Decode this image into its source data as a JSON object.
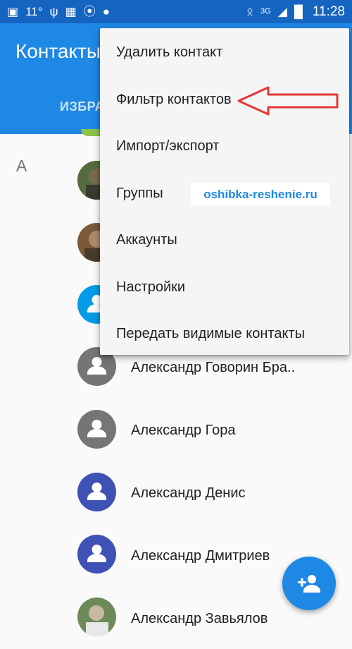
{
  "status_bar": {
    "temperature": "11°",
    "network": "3G",
    "time": "11:28"
  },
  "app_bar": {
    "title": "Контакты",
    "tab_favorites": "ИЗБРА"
  },
  "contacts": {
    "section_letter": "А",
    "items": [
      {
        "name": ""
      },
      {
        "name": ""
      },
      {
        "name": ""
      },
      {
        "name": "Александр Говорин Бра.."
      },
      {
        "name": "Александр Гора"
      },
      {
        "name": "Александр Денис"
      },
      {
        "name": "Александр Дмитриев"
      },
      {
        "name": "Александр Завьялов"
      }
    ]
  },
  "menu": {
    "items": [
      {
        "label": "Удалить контакт"
      },
      {
        "label": "Фильтр контактов"
      },
      {
        "label": "Импорт/экспорт"
      },
      {
        "label": "Группы"
      },
      {
        "label": "Аккаунты"
      },
      {
        "label": "Настройки"
      },
      {
        "label": "Передать видимые контакты"
      }
    ]
  },
  "watermark": "oshibka-reshenie.ru",
  "colors": {
    "status_bar": "#1565c0",
    "app_bar": "#1e88e5",
    "menu_bg": "#f5f5f5",
    "avatar_gray": "#757575",
    "avatar_indigo": "#3f51b5",
    "avatar_blue": "#039be5",
    "annotation_arrow": "#e53935"
  },
  "icons": {
    "fab": "add-person-icon",
    "avatar_default": "person-icon"
  }
}
